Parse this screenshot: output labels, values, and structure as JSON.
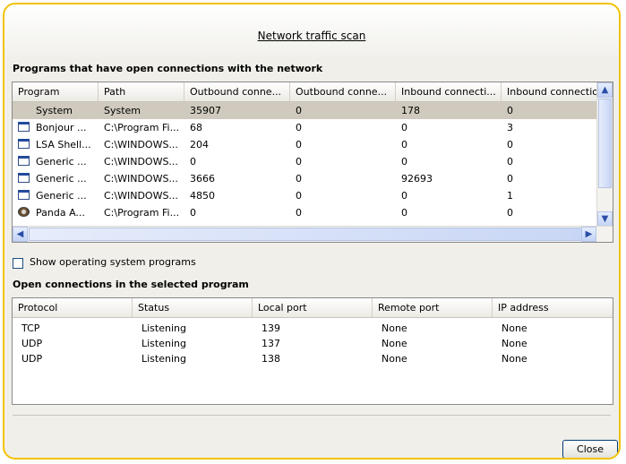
{
  "window": {
    "title": "Network traffic scan",
    "accent_border": "#f2c200"
  },
  "programs_section": {
    "label": "Programs that have open connections with the network",
    "columns": [
      "Program",
      "Path",
      "Outbound conne...",
      "Outbound conne...",
      "Inbound connecti...",
      "Inbound connectio.."
    ],
    "rows": [
      {
        "icon": "blank",
        "program": "System",
        "path": "System",
        "c1": "35907",
        "c2": "0",
        "c3": "178",
        "c4": "0",
        "selected": true
      },
      {
        "icon": "window-icon",
        "program": "Bonjour ...",
        "path": "C:\\Program Fi...",
        "c1": "68",
        "c2": "0",
        "c3": "0",
        "c4": "3"
      },
      {
        "icon": "window-icon",
        "program": "LSA Shell...",
        "path": "C:\\WINDOWS...",
        "c1": "204",
        "c2": "0",
        "c3": "0",
        "c4": "0"
      },
      {
        "icon": "window-icon",
        "program": "Generic ...",
        "path": "C:\\WINDOWS...",
        "c1": "0",
        "c2": "0",
        "c3": "0",
        "c4": "0"
      },
      {
        "icon": "window-icon",
        "program": "Generic ...",
        "path": "C:\\WINDOWS...",
        "c1": "3666",
        "c2": "0",
        "c3": "92693",
        "c4": "0"
      },
      {
        "icon": "window-icon",
        "program": "Generic ...",
        "path": "C:\\WINDOWS...",
        "c1": "4850",
        "c2": "0",
        "c3": "0",
        "c4": "1"
      },
      {
        "icon": "gear-icon",
        "program": "Panda A...",
        "path": "C:\\Program Fi...",
        "c1": "0",
        "c2": "0",
        "c3": "0",
        "c4": "0"
      }
    ]
  },
  "show_os_programs": {
    "label": "Show operating system programs",
    "checked": false
  },
  "connections_section": {
    "label": "Open connections in the selected program",
    "columns": [
      "Protocol",
      "Status",
      "Local port",
      "Remote port",
      "IP address"
    ],
    "rows": [
      {
        "protocol": "TCP",
        "status": "Listening",
        "local": "139",
        "remote": "None",
        "ip": "None"
      },
      {
        "protocol": "UDP",
        "status": "Listening",
        "local": "137",
        "remote": "None",
        "ip": "None"
      },
      {
        "protocol": "UDP",
        "status": "Listening",
        "local": "138",
        "remote": "None",
        "ip": "None"
      }
    ]
  },
  "footer": {
    "close_label": "Close"
  }
}
